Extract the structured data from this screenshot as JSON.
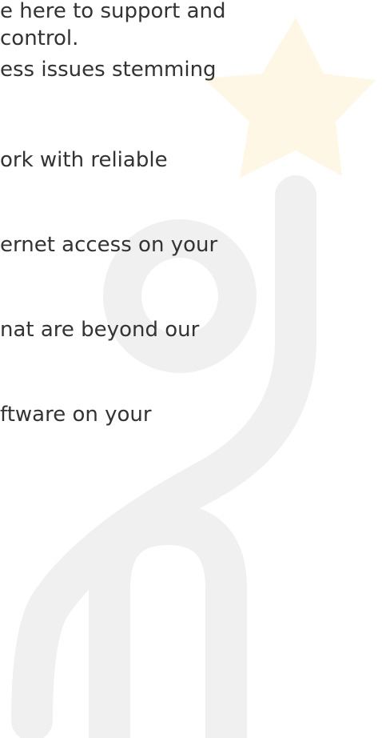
{
  "lines": [
    "e here to support and",
    "control.",
    "ess issues stemming",
    "ork with reliable",
    "ernet access on your",
    "nat are beyond our",
    "ftware on your"
  ],
  "colors": {
    "text": "#333333",
    "watermark_gray": "#f0f0f0",
    "watermark_star": "#fff7e6"
  }
}
